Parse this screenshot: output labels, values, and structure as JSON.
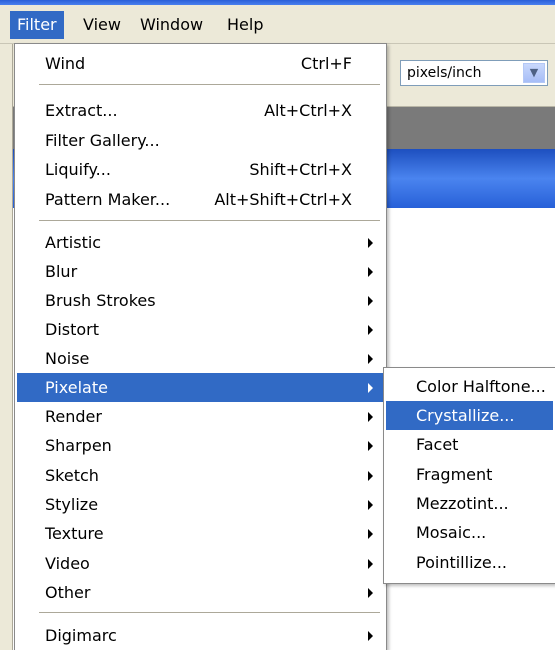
{
  "menubar": {
    "items": [
      "Filter",
      "View",
      "Window",
      "Help"
    ],
    "active_index": 0
  },
  "options_bar": {
    "units_select_value": "pixels/inch"
  },
  "filter_menu": {
    "wind": {
      "label": "Wind",
      "shortcut": "Ctrl+F"
    },
    "extract": {
      "label": "Extract...",
      "shortcut": "Alt+Ctrl+X"
    },
    "filter_gallery": {
      "label": "Filter Gallery..."
    },
    "liquify": {
      "label": "Liquify...",
      "shortcut": "Shift+Ctrl+X"
    },
    "pattern_maker": {
      "label": "Pattern Maker...",
      "shortcut": "Alt+Shift+Ctrl+X"
    },
    "categories": [
      "Artistic",
      "Blur",
      "Brush Strokes",
      "Distort",
      "Noise",
      "Pixelate",
      "Render",
      "Sharpen",
      "Sketch",
      "Stylize",
      "Texture",
      "Video",
      "Other"
    ],
    "highlighted_category": "Pixelate",
    "digimarc": {
      "label": "Digimarc"
    }
  },
  "pixelate_submenu": {
    "items": [
      "Color Halftone...",
      "Crystallize...",
      "Facet",
      "Fragment",
      "Mezzotint...",
      "Mosaic...",
      "Pointillize..."
    ],
    "highlighted_item": "Crystallize..."
  },
  "colors": {
    "menu_highlight": "#316ac5",
    "menubar_bg": "#ece9d8",
    "title_blue": "#2a5fd8"
  }
}
